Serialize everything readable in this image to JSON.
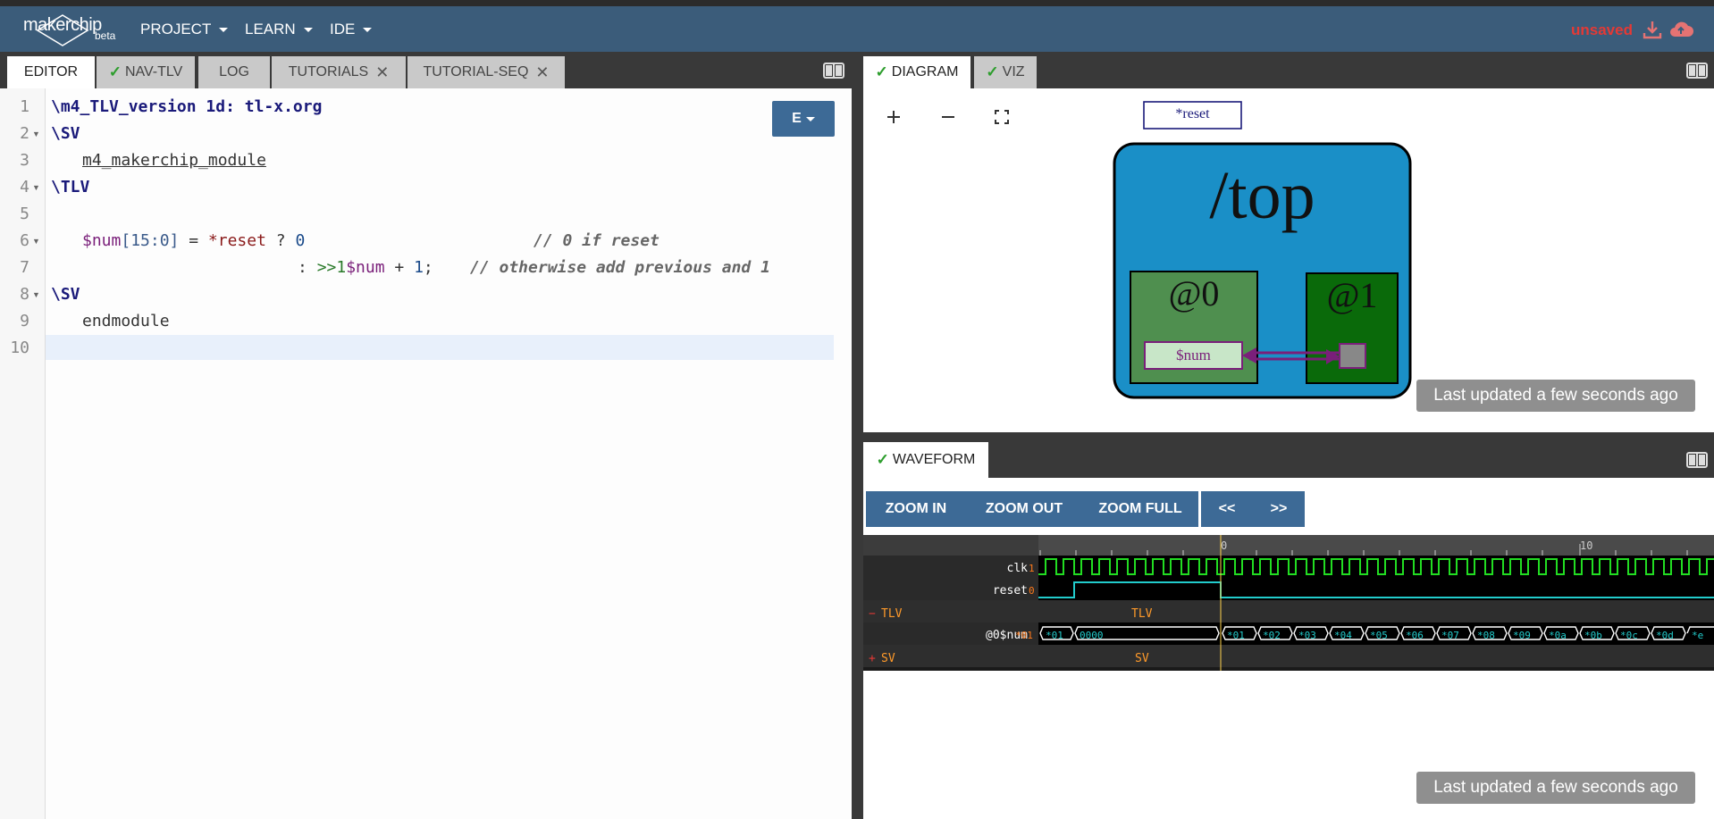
{
  "app": {
    "logo_text": "makerchip",
    "logo_badge": "beta",
    "status": "unsaved"
  },
  "menu": [
    {
      "label": "PROJECT"
    },
    {
      "label": "LEARN"
    },
    {
      "label": "IDE"
    }
  ],
  "left_tabs": [
    {
      "label": "EDITOR",
      "active": true
    },
    {
      "label": "NAV-TLV",
      "ok": true
    },
    {
      "label": "LOG"
    },
    {
      "label": "TUTORIALS",
      "closable": true
    },
    {
      "label": "TUTORIAL-SEQ",
      "closable": true
    }
  ],
  "right_tabs": [
    {
      "label": "DIAGRAM",
      "ok": true,
      "active": true
    },
    {
      "label": "VIZ",
      "ok": true
    }
  ],
  "waveform_tab": {
    "label": "WAVEFORM",
    "ok": true
  },
  "editor": {
    "mode_button": "E",
    "line_numbers": [
      "1",
      "2",
      "3",
      "4",
      "5",
      "6",
      "7",
      "8",
      "9",
      "10"
    ],
    "lines": [
      "\\m4_TLV_version 1d: tl-x.org",
      "\\SV",
      "m4_makerchip_module",
      "\\TLV",
      "",
      "$num[15:0] = *reset ? 0                    // 0 if reset",
      ": >>1$num + 1;  // otherwise add previous and 1",
      "\\SV",
      "endmodule",
      ""
    ],
    "l6": {
      "sig": "$num",
      "range": "[15:0]",
      "eq": " = ",
      "star": "*reset",
      "q": " ? ",
      "zero": "0",
      "comment": "// 0 if reset"
    },
    "l7": {
      "colon": ": ",
      "pipe": ">>1",
      "sig": "$num",
      "rest": " + ",
      "one": "1",
      "semi": ";",
      "comment": "// otherwise add previous and 1"
    }
  },
  "diagram": {
    "reset_label": "*reset",
    "scope": "/top",
    "stage0": "@0",
    "stage1": "@1",
    "signal": "$num",
    "last_updated": "Last updated a few seconds ago"
  },
  "waveform": {
    "buttons": [
      "ZOOM IN",
      "ZOOM OUT",
      "ZOOM FULL"
    ],
    "nav_buttons": [
      "<<",
      ">>"
    ],
    "ruler": [
      "0",
      "10"
    ],
    "signals": [
      {
        "name": "clk",
        "value": "1"
      },
      {
        "name": "reset",
        "value": "0"
      }
    ],
    "groups": [
      {
        "name": "TLV",
        "label": "TLV"
      },
      {
        "name": "SV",
        "label": "SV"
      }
    ],
    "num_signal": {
      "name": "@0$num",
      "value": "*01"
    },
    "num_values": [
      "*01",
      "0000",
      "*01",
      "*02",
      "*03",
      "*04",
      "*05",
      "*06",
      "*07",
      "*08",
      "*09",
      "*0a",
      "*0b",
      "*0c",
      "*0d",
      "*e"
    ],
    "last_updated": "Last updated a few seconds ago"
  },
  "colors": {
    "navbar": "#3b5c7a",
    "button": "#3d6a96",
    "accent_red": "#e53935",
    "diagram_top": "#1a8fc7",
    "stage0": "#4f8f4f",
    "stage1": "#0a6a0a",
    "wave_green": "#22dd22",
    "wave_cyan": "#22cccc"
  },
  "icons": [
    "download-icon",
    "cloud-upload-icon",
    "split-panel-icon",
    "zoom-plus-icon",
    "zoom-minus-icon",
    "fullscreen-icon",
    "check-icon",
    "close-icon"
  ]
}
